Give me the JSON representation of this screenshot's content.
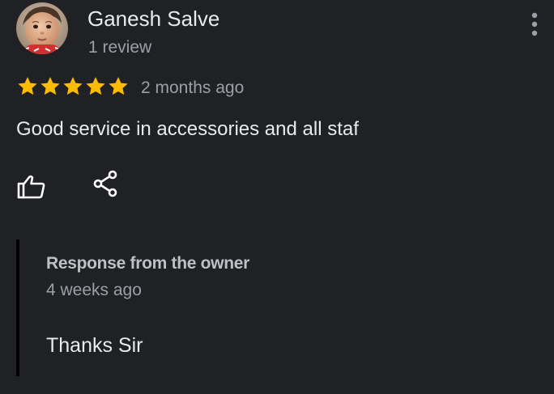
{
  "review": {
    "reviewer": {
      "name": "Ganesh Salve",
      "review_count": "1 review",
      "avatar_icon": "child-photo-avatar"
    },
    "rating": {
      "stars": 5,
      "max": 5,
      "color": "#fbbc04"
    },
    "date": "2 months ago",
    "text": "Good service in accessories and all staf",
    "actions": {
      "like_icon": "thumbs-up-icon",
      "share_icon": "share-icon",
      "menu_icon": "more-vert-icon"
    }
  },
  "owner_response": {
    "label": "Response from the owner",
    "date": "4 weeks ago",
    "text": "Thanks Sir"
  },
  "colors": {
    "background": "#202124",
    "primary_text": "#e8eaed",
    "secondary_text": "#9aa0a6",
    "star": "#fbbc04",
    "response_bar": "#000000"
  }
}
